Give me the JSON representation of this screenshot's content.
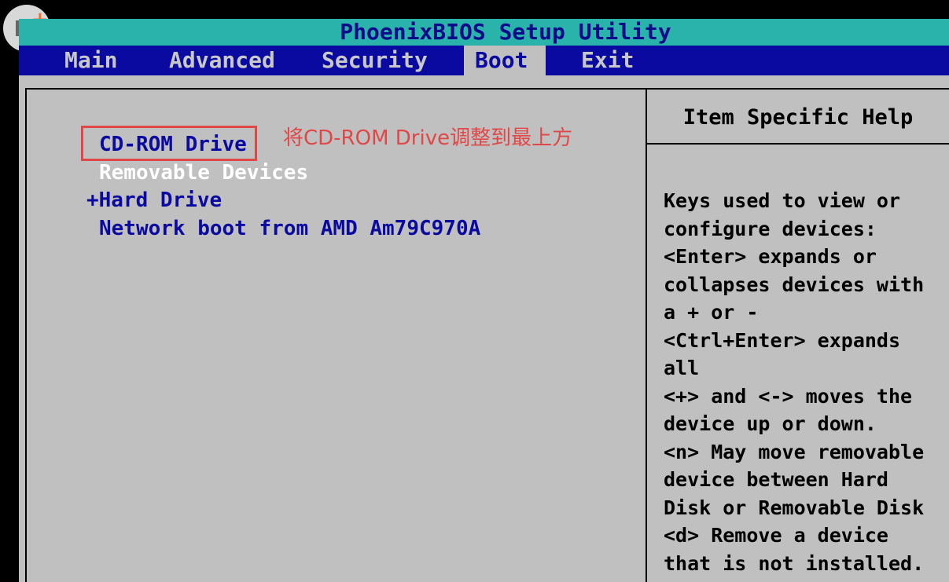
{
  "title": "PhoenixBIOS Setup Utility",
  "tabs": [
    {
      "label": "Main"
    },
    {
      "label": "Advanced"
    },
    {
      "label": "Security"
    },
    {
      "label": "Boot"
    },
    {
      "label": "Exit"
    }
  ],
  "active_tab": "Boot",
  "boot_items": [
    {
      "label": "CD-ROM Drive"
    },
    {
      "label": "Removable Devices"
    },
    {
      "label": "+Hard Drive"
    },
    {
      "label": "Network boot from AMD Am79C970A"
    }
  ],
  "annotation": "将CD-ROM Drive调整到最上方",
  "help": {
    "title": "Item Specific Help",
    "lines": [
      "Keys used to view or",
      "configure devices:",
      "<Enter> expands or",
      "collapses devices with",
      "a + or -",
      "<Ctrl+Enter> expands",
      "all",
      "<+> and <-> moves the",
      "device up or down.",
      "<n> May move removable",
      "device between Hard",
      "Disk or Removable Disk",
      "<d> Remove a device",
      "that is not installed."
    ]
  },
  "colors": {
    "title_bar": "#2ab3ab",
    "menu_bar": "#0a0aa0",
    "panel": "#c0c0c0",
    "annotation": "#e04848"
  },
  "icons": {
    "logo": "watermark-logo-icon"
  }
}
